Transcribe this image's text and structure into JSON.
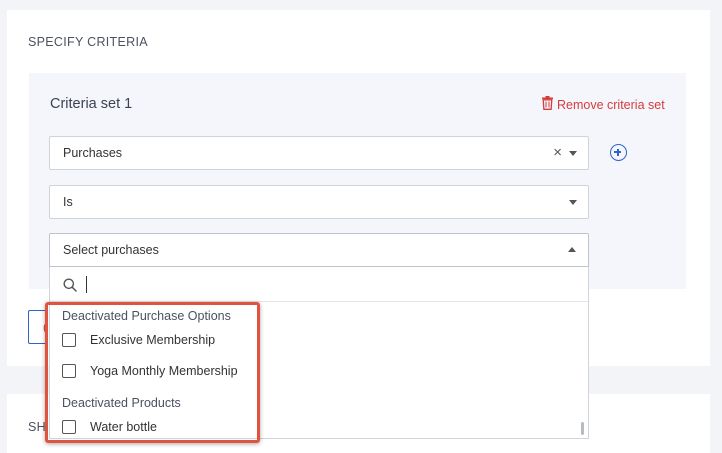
{
  "section": {
    "title": "SPECIFY CRITERIA",
    "next_title_partial": "SH"
  },
  "criteria_set": {
    "title": "Criteria set 1",
    "remove_label": "Remove criteria set"
  },
  "fields": {
    "category": {
      "value": "Purchases",
      "clear": "×"
    },
    "operator": {
      "value": "Is"
    },
    "items": {
      "placeholder": "Select purchases"
    }
  },
  "dropdown": {
    "search_value": "",
    "groups": [
      {
        "label": "Deactivated Purchase Options",
        "options": [
          {
            "label": "Exclusive Membership",
            "checked": false
          },
          {
            "label": "Yoga Monthly Membership",
            "checked": false
          }
        ]
      },
      {
        "label": "Deactivated Products",
        "options": [
          {
            "label": "Water bottle",
            "checked": false
          }
        ]
      }
    ]
  },
  "colors": {
    "accent": "#2f63c8",
    "danger": "#d63b3b",
    "highlight": "#e0533f",
    "panel": "#f4f6fc",
    "page": "#f2f4f8"
  },
  "icons": {
    "remove": "trash-icon",
    "add": "plus-circle-icon",
    "search": "search-icon"
  }
}
